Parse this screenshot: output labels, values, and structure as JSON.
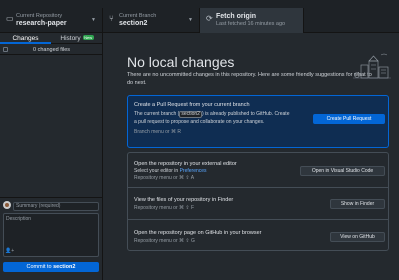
{
  "toolbar": {
    "repo": {
      "caption": "Current Repository",
      "name": "research-paper"
    },
    "branch": {
      "caption": "Current Branch",
      "name": "section2"
    },
    "fetch": {
      "title": "Fetch origin",
      "subtitle": "Last fetched 16 minutes ago"
    }
  },
  "sidebar": {
    "tabs": [
      {
        "label": "Changes"
      },
      {
        "label": "History",
        "badge": "New"
      }
    ],
    "changed_files": "0 changed files",
    "summary_placeholder": "Summary (required)",
    "description_placeholder": "Description",
    "commit_prefix": "Commit to ",
    "commit_branch": "section2"
  },
  "main": {
    "title": "No local changes",
    "intro": "There are no uncommitted changes in this repository. Here are some friendly suggestions for what to do next.",
    "pr_card": {
      "title": "Create a Pull Request from your current branch",
      "line1_pre": "The current branch (",
      "branch": "section2",
      "line1_post": ") is already published to GitHub. Create",
      "line2": "a pull request to propose and collaborate on your changes.",
      "hint": "Branch menu or ⌘ R",
      "button": "Create Pull Request"
    },
    "editor_card": {
      "title": "Open the repository in your external editor",
      "sub_pre": "Select your editor in ",
      "sub_link": "Preferences",
      "hint": "Repository menu or ⌘ ⇧ A",
      "button": "Open in Visual Studio Code"
    },
    "finder_card": {
      "title": "View the files of your repository in Finder",
      "hint": "Repository menu or ⌘ ⇧ F",
      "button": "Show in Finder"
    },
    "github_card": {
      "title": "Open the repository page on GitHub in your browser",
      "hint": "Repository menu or ⌘ ⇧ G",
      "button": "View on GitHub"
    }
  },
  "icons": {
    "repo": "repo-icon",
    "branch": "git-branch-icon",
    "fetch": "sync-icon",
    "coauthor": "person-add-icon"
  },
  "colors": {
    "accent": "#0366d6",
    "background": "#24292e"
  }
}
